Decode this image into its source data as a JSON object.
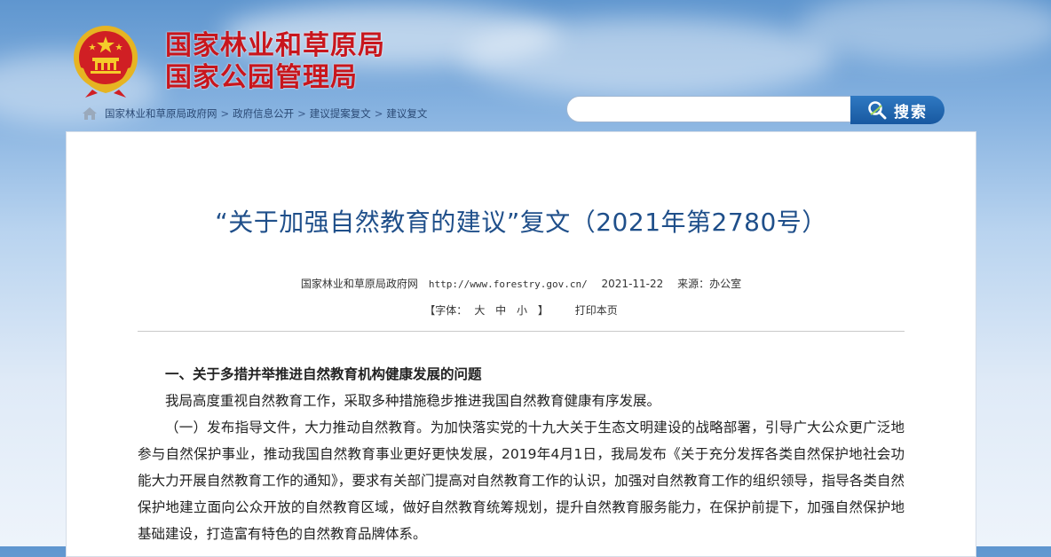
{
  "header": {
    "agency_line1": "国家林业和草原局",
    "agency_line2": "国家公园管理局",
    "emblem_icon": "national-emblem-icon"
  },
  "breadcrumb": {
    "home_icon": "home-icon",
    "items": [
      "国家林业和草原局政府网",
      "政府信息公开",
      "建议提案复文",
      "建议复文"
    ],
    "separator": ">"
  },
  "search": {
    "input_value": "",
    "button_label": "搜索",
    "icon": "search-icon"
  },
  "article": {
    "title": "“关于加强自然教育的建议”复文（2021年第2780号）",
    "source": "国家林业和草原局政府网",
    "url": "http://www.forestry.gov.cn/",
    "date": "2021-11-22",
    "origin": "来源：办公室",
    "font_size_label_open": "【字体：",
    "font_large": "大",
    "font_medium": "中",
    "font_small": "小",
    "font_size_label_close": "】",
    "print_label": "打印本页",
    "section_heading": "一、关于多措并举推进自然教育机构健康发展的问题",
    "paragraph1": "我局高度重视自然教育工作，采取多种措施稳步推进我国自然教育健康有序发展。",
    "paragraph2": "（一）发布指导文件，大力推动自然教育。为加快落实党的十九大关于生态文明建设的战略部署，引导广大公众更广泛地参与自然保护事业，推动我国自然教育事业更好更快发展，2019年4月1日，我局发布《关于充分发挥各类自然保护地社会功能大力开展自然教育工作的通知》，要求有关部门提高对自然教育工作的认识，加强对自然教育工作的组织领导，指导各类自然保护地建立面向公众开放的自然教育区域，做好自然教育统筹规划，提升自然教育服务能力，在保护前提下，加强自然保护地基础建设，打造富有特色的自然教育品牌体系。"
  },
  "colors": {
    "agency_red": "#c8161d",
    "title_blue": "#1f4f8a",
    "search_button": "#1f63ab"
  }
}
